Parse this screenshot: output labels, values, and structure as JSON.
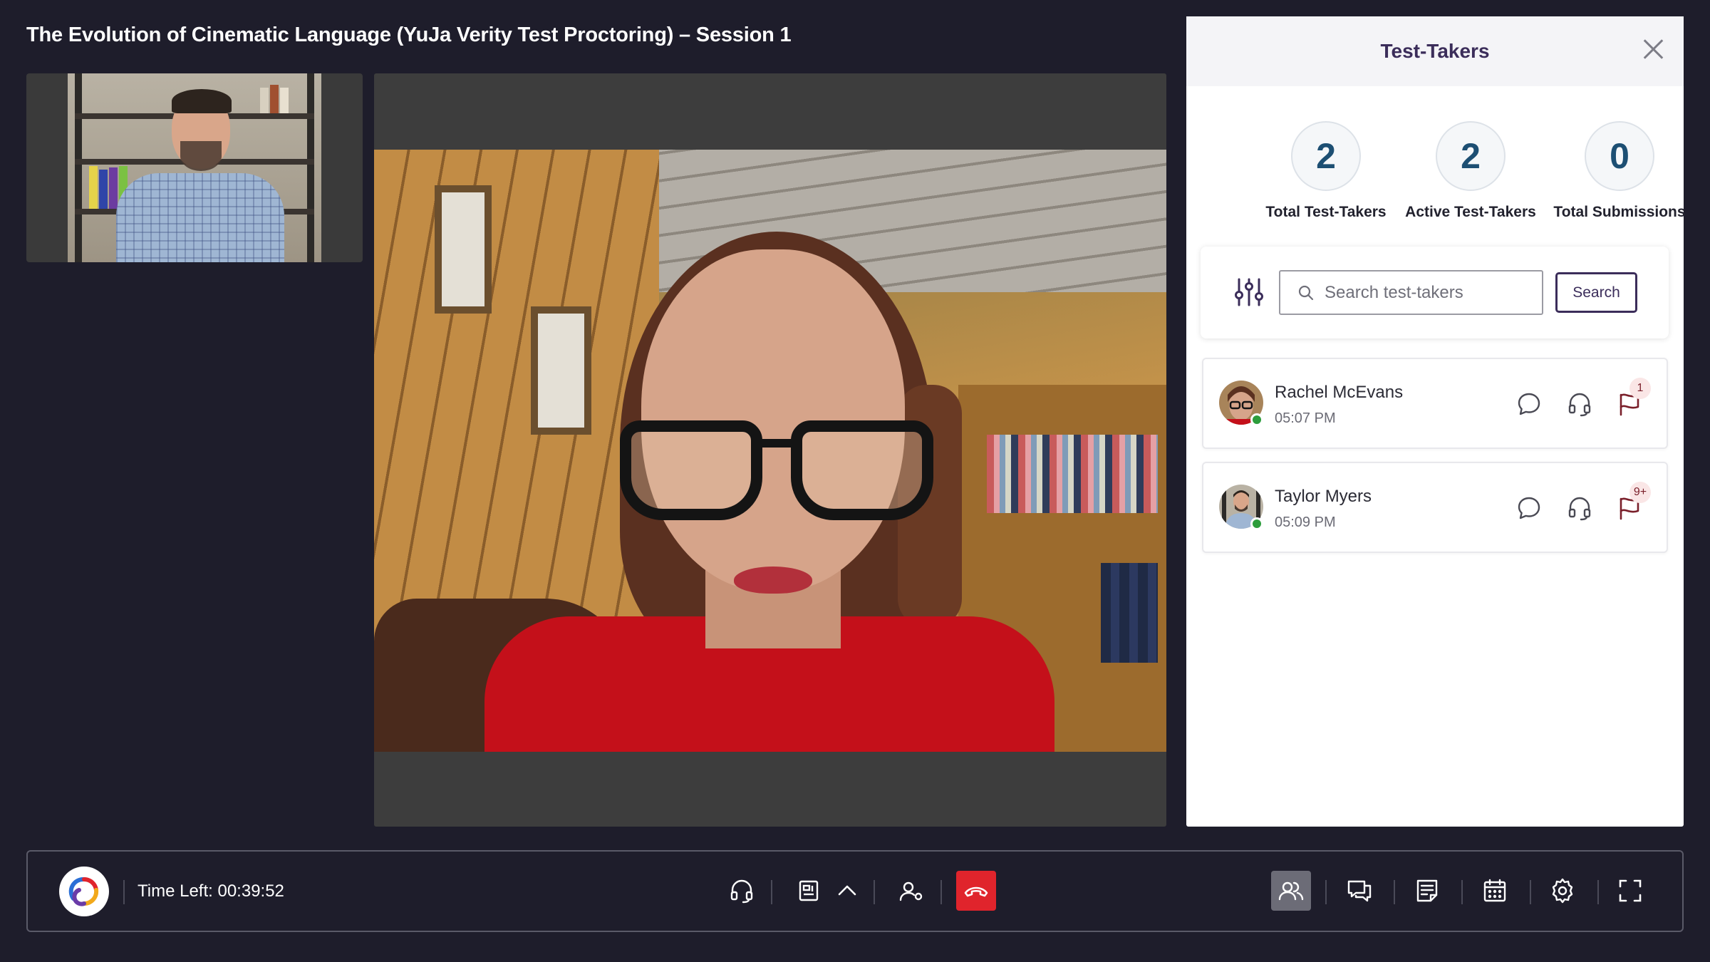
{
  "session": {
    "title": "The Evolution of Cinematic Language (YuJa Verity Test Proctoring) – Session 1"
  },
  "panel": {
    "title": "Test-Takers",
    "stats": [
      {
        "value": "2",
        "label": "Total Test-Takers"
      },
      {
        "value": "2",
        "label": "Active Test-Takers"
      },
      {
        "value": "0",
        "label": "Total Submissions"
      }
    ],
    "search": {
      "placeholder": "Search test-takers",
      "value": "",
      "button_label": "Search"
    },
    "test_takers": [
      {
        "name": "Rachel McEvans",
        "time": "05:07 PM",
        "flag_count": "1",
        "status": "online"
      },
      {
        "name": "Taylor Myers",
        "time": "05:09 PM",
        "flag_count": "9+",
        "status": "online"
      }
    ]
  },
  "toolbar": {
    "time_left": "Time Left: 00:39:52",
    "icons": {
      "audio": "headphones-icon",
      "layout": "layout-icon",
      "expand": "chevron-up-icon",
      "user_settings": "user-settings-icon",
      "end_call": "hang-up-icon",
      "participants": "participants-icon",
      "chat": "chat-icon",
      "notes": "notes-icon",
      "calendar": "calendar-icon",
      "settings": "gear-icon",
      "fullscreen": "fullscreen-icon"
    }
  },
  "colors": {
    "background": "#1e1d2b",
    "brand_purple": "#3b2d5a",
    "stat_number": "#1d4f73",
    "online": "#2d9d3c",
    "end_call": "#e0242c",
    "flag": "#7a1f2a"
  }
}
